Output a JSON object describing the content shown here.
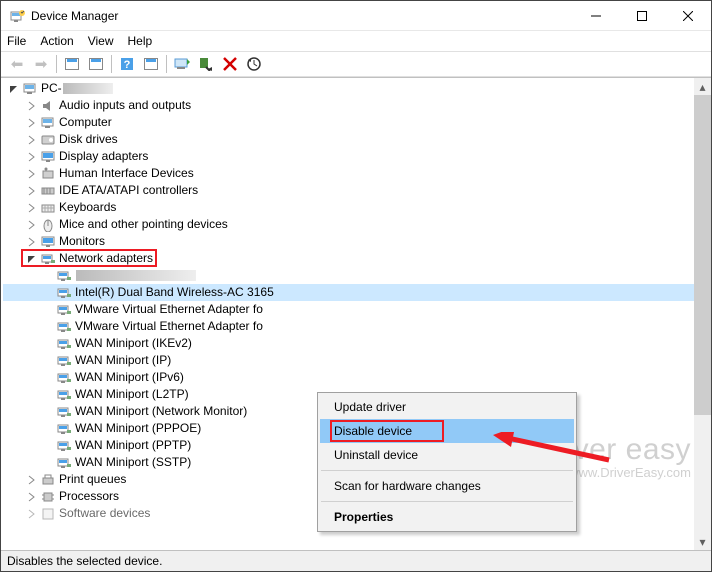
{
  "window": {
    "title": "Device Manager"
  },
  "menus": {
    "file": "File",
    "action": "Action",
    "view": "View",
    "help": "Help"
  },
  "tree": {
    "root": {
      "label_prefix": "PC-"
    },
    "categories": [
      {
        "label": "Audio inputs and outputs",
        "icon": "speaker-icon"
      },
      {
        "label": "Computer",
        "icon": "computer-icon"
      },
      {
        "label": "Disk drives",
        "icon": "disk-icon"
      },
      {
        "label": "Display adapters",
        "icon": "display-icon"
      },
      {
        "label": "Human Interface Devices",
        "icon": "hid-icon"
      },
      {
        "label": "IDE ATA/ATAPI controllers",
        "icon": "ide-icon"
      },
      {
        "label": "Keyboards",
        "icon": "keyboard-icon"
      },
      {
        "label": "Mice and other pointing devices",
        "icon": "mouse-icon"
      },
      {
        "label": "Monitors",
        "icon": "monitor-icon"
      },
      {
        "label": "Network adapters",
        "icon": "network-icon",
        "expanded": true,
        "red_box": true
      },
      {
        "label": "Print queues",
        "icon": "printer-icon"
      },
      {
        "label": "Processors",
        "icon": "cpu-icon"
      },
      {
        "label": "Software devices",
        "icon": "software-icon"
      }
    ],
    "network_children": [
      {
        "label_hidden": true
      },
      {
        "label": "Intel(R) Dual Band Wireless-AC 3165",
        "selected": true
      },
      {
        "label": "VMware Virtual Ethernet Adapter fo"
      },
      {
        "label": "VMware Virtual Ethernet Adapter fo"
      },
      {
        "label": "WAN Miniport (IKEv2)"
      },
      {
        "label": "WAN Miniport (IP)"
      },
      {
        "label": "WAN Miniport (IPv6)"
      },
      {
        "label": "WAN Miniport (L2TP)"
      },
      {
        "label": "WAN Miniport (Network Monitor)"
      },
      {
        "label": "WAN Miniport (PPPOE)"
      },
      {
        "label": "WAN Miniport (PPTP)"
      },
      {
        "label": "WAN Miniport (SSTP)"
      }
    ]
  },
  "context_menu": {
    "items": [
      {
        "label": "Update driver"
      },
      {
        "label": "Disable device",
        "hover": true,
        "red_box": true
      },
      {
        "label": "Uninstall device"
      },
      {
        "sep": true
      },
      {
        "label": "Scan for hardware changes"
      },
      {
        "sep": true
      },
      {
        "label": "Properties",
        "bold": true
      }
    ]
  },
  "statusbar": {
    "text": "Disables the selected device."
  },
  "watermark": {
    "big": "driver easy",
    "small": "www.DriverEasy.com"
  }
}
